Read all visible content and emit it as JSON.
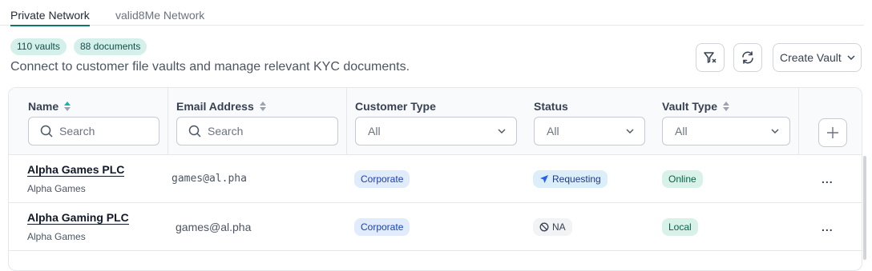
{
  "tabs": [
    {
      "label": "Private Network",
      "active": true
    },
    {
      "label": "valid8Me Network",
      "active": false
    }
  ],
  "counts": {
    "vaults": "110 vaults",
    "documents": "88 documents"
  },
  "subtitle": "Connect to customer file vaults and manage relevant KYC documents.",
  "toolbar": {
    "clear_filter_icon": "filter-clear-icon",
    "refresh_icon": "refresh-icon",
    "create_vault_label": "Create Vault"
  },
  "columns": {
    "name": {
      "label": "Name",
      "search_placeholder": "Search",
      "sort": "ascending"
    },
    "email": {
      "label": "Email Address",
      "search_placeholder": "Search",
      "sort": "none"
    },
    "customer_type": {
      "label": "Customer Type",
      "selected": "All"
    },
    "status": {
      "label": "Status",
      "selected": "All"
    },
    "vault_type": {
      "label": "Vault Type",
      "selected": "All",
      "sort": "none"
    }
  },
  "rows": [
    {
      "name": "Alpha Games PLC",
      "sub": "Alpha Games",
      "email": "games@al.pha",
      "customer_type": "Corporate",
      "status": "Requesting",
      "status_icon": "send-icon",
      "vault_type": "Online"
    },
    {
      "name": "Alpha Gaming PLC",
      "sub": "Alpha Games",
      "email": "games@al.pha",
      "customer_type": "Corporate",
      "status": "NA",
      "status_icon": "ban-icon",
      "vault_type": "Local"
    }
  ],
  "row_action": "...",
  "colors": {
    "accent": "#0f766e",
    "pill_bg": "#d5f0ea"
  }
}
